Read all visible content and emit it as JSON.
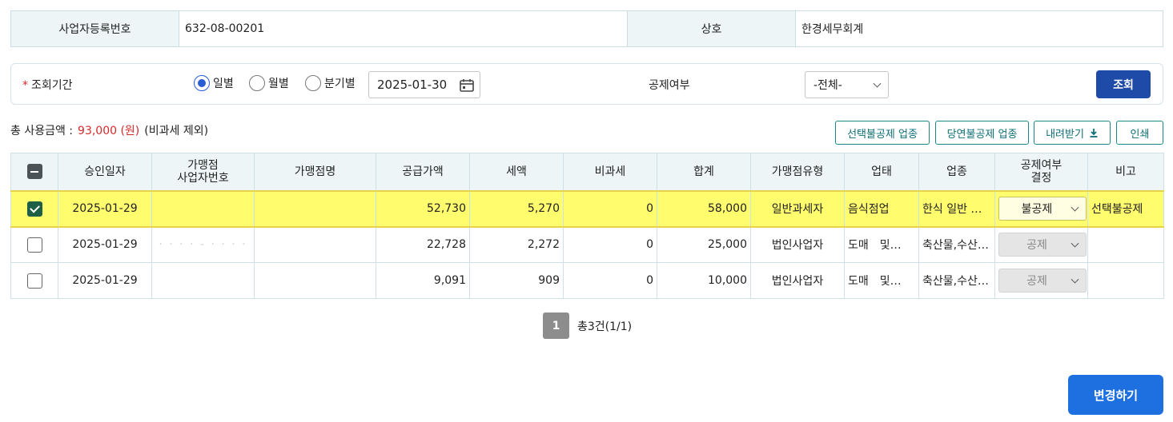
{
  "info": {
    "biz_no_label": "사업자등록번호",
    "biz_no_value": "632-08-00201",
    "company_label": "상호",
    "company_value": "한경세무회계"
  },
  "search": {
    "required_mark": "*",
    "period_label": "조회기간",
    "radios": [
      {
        "label": "일별",
        "checked": true
      },
      {
        "label": "월별",
        "checked": false
      },
      {
        "label": "분기별",
        "checked": false
      }
    ],
    "date_value": "2025-01-30",
    "deduction_label": "공제여부",
    "deduction_select": "-전체-",
    "query_button": "조회"
  },
  "summary": {
    "total_label": "총 사용금액 :",
    "total_amount": "93,000 (원)",
    "note": "(비과세 제외)"
  },
  "actions": {
    "selective": "선택불공제 업종",
    "mandatory": "당연불공제 업종",
    "download": "내려받기",
    "print": "인쇄"
  },
  "table": {
    "headers": {
      "approve_date": "승인일자",
      "merchant_bizno_1": "가맹점",
      "merchant_bizno_2": "사업자번호",
      "merchant_name": "가맹점명",
      "supply": "공급가액",
      "tax": "세액",
      "taxfree": "비과세",
      "total": "합계",
      "merchant_type": "가맹점유형",
      "business": "업태",
      "category": "업종",
      "deduct_1": "공제여부",
      "deduct_2": "결정",
      "remark": "비고"
    },
    "rows": [
      {
        "checked": true,
        "date": "2025-01-29",
        "bizno": "",
        "name": "",
        "supply": "52,730",
        "tax": "5,270",
        "taxfree": "0",
        "total": "58,000",
        "type": "일반과세자",
        "business": "음식점업",
        "category": "한식 일반 …",
        "deduct": "불공제",
        "deduct_enabled": true,
        "remark": "선택불공제"
      },
      {
        "checked": false,
        "date": "2025-01-29",
        "bizno": "· · · · - · ·   · ·",
        "name": "",
        "supply": "22,728",
        "tax": "2,272",
        "taxfree": "0",
        "total": "25,000",
        "type": "법인사업자",
        "business": "도매　및…",
        "category": "축산물,수산…",
        "deduct": "공제",
        "deduct_enabled": false,
        "remark": ""
      },
      {
        "checked": false,
        "date": "2025-01-29",
        "bizno": "",
        "name": "",
        "supply": "9,091",
        "tax": "909",
        "taxfree": "0",
        "total": "10,000",
        "type": "법인사업자",
        "business": "도매　및…",
        "category": "축산물,수산…",
        "deduct": "공제",
        "deduct_enabled": false,
        "remark": ""
      }
    ]
  },
  "pagination": {
    "current": "1",
    "info": "총3건(1/1)"
  },
  "change_button": "변경하기"
}
